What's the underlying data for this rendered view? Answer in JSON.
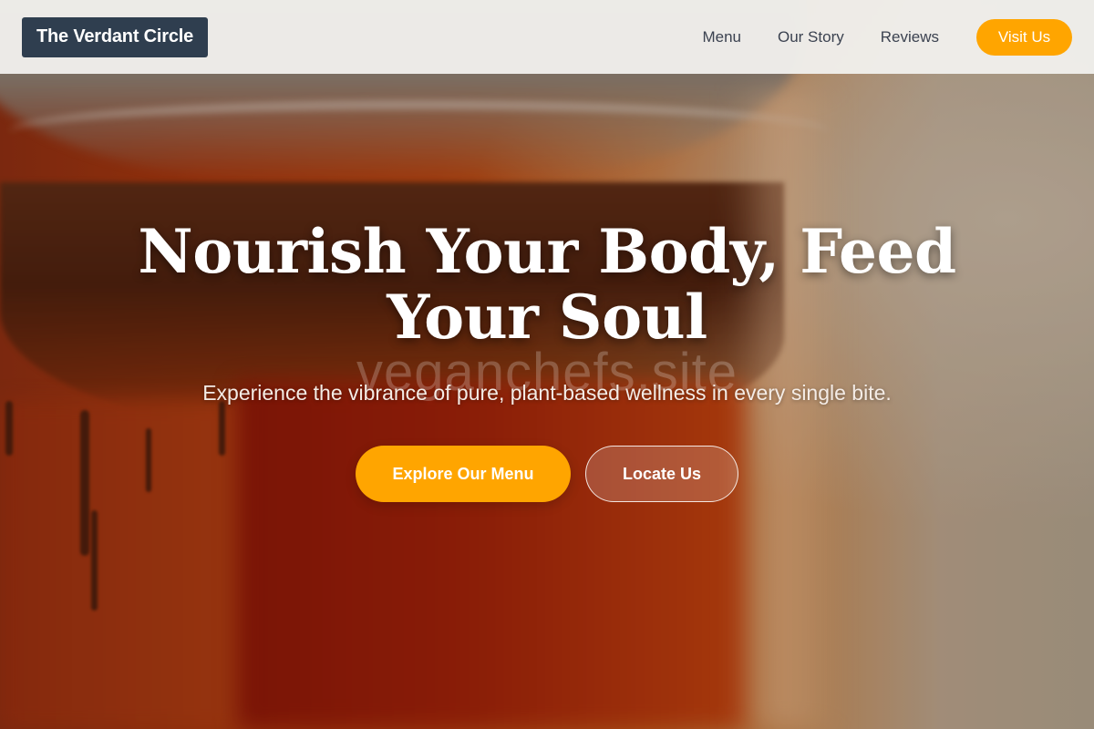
{
  "header": {
    "logo": "The Verdant Circle",
    "nav": [
      {
        "label": "Menu"
      },
      {
        "label": "Our Story"
      },
      {
        "label": "Reviews"
      }
    ],
    "cta": "Visit Us"
  },
  "hero": {
    "title": "Nourish Your Body, Feed Your Soul",
    "watermark": "veganchefs.site",
    "subtitle": "Experience the vibrance of pure, plant-based wellness in every single bite.",
    "primary_button": "Explore Our Menu",
    "secondary_button": "Locate Us"
  },
  "colors": {
    "accent": "#ffa500",
    "logo_bg": "#2f3e4f",
    "header_bg": "#f0efec",
    "nav_text": "#3b4250"
  }
}
